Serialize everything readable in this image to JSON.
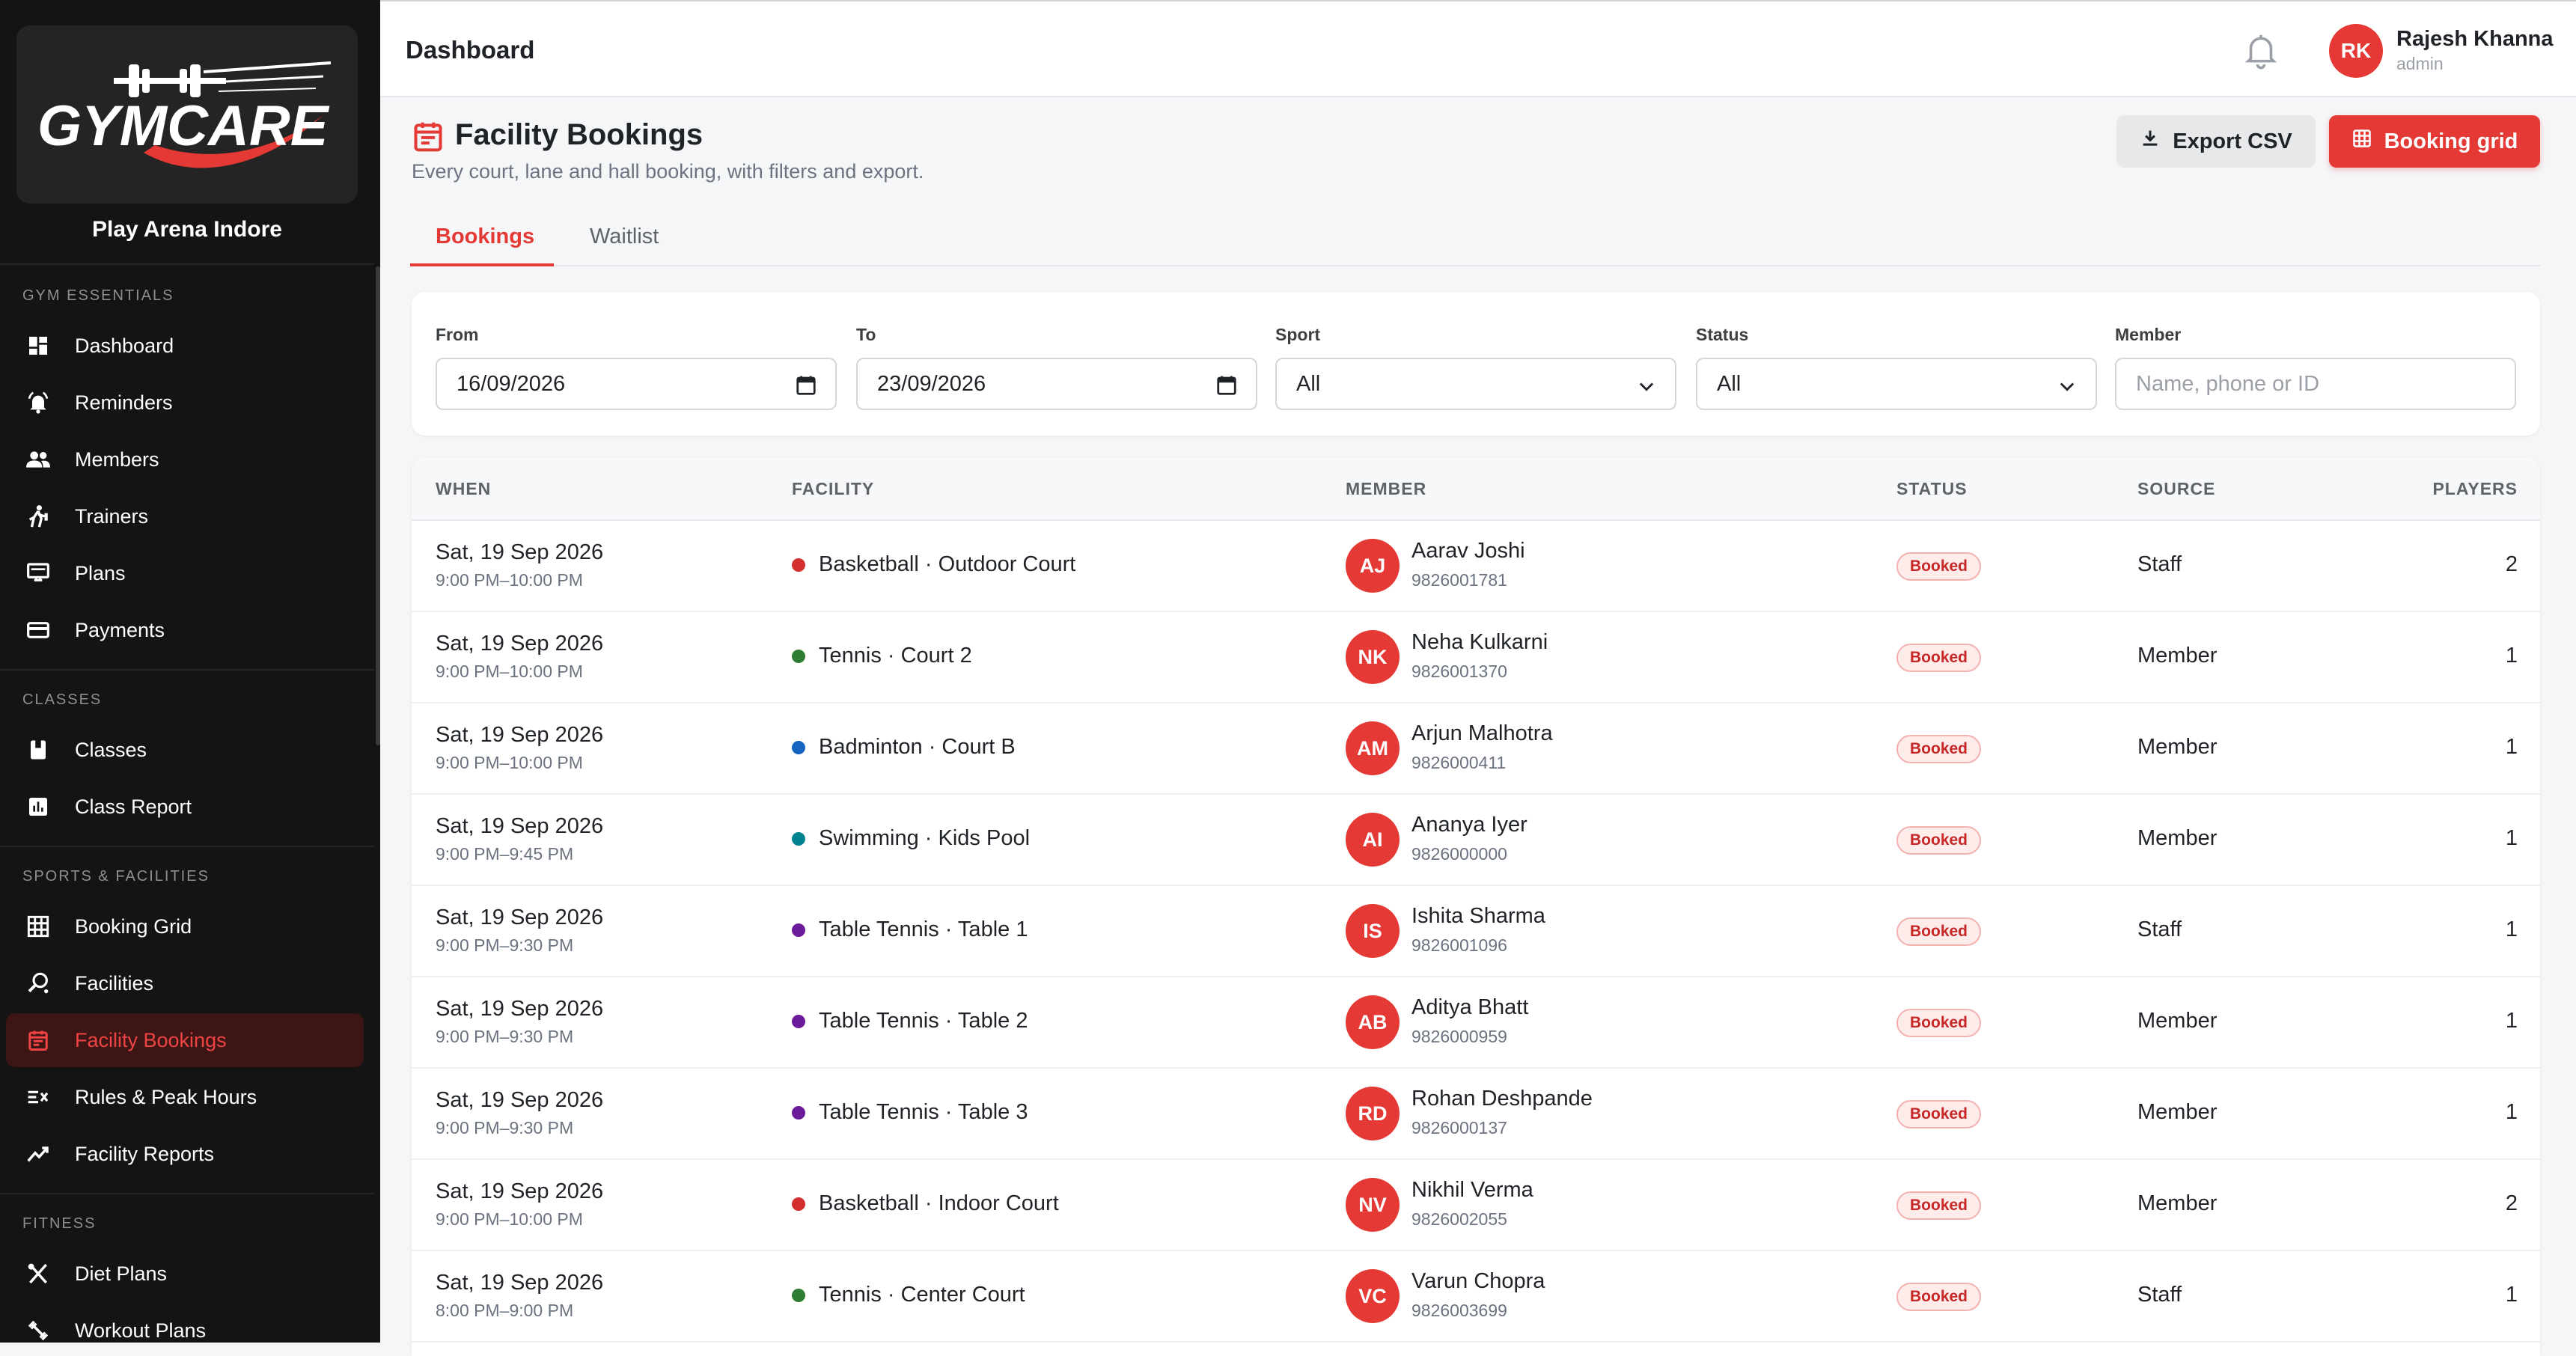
{
  "brand": {
    "logo_text": "GYMCARE",
    "arena": "Play Arena Indore"
  },
  "colors": {
    "accent": "#e53935",
    "sidebar_bg": "#141414",
    "active_bg": "#3d1515"
  },
  "sidebar": {
    "sections": [
      {
        "label": "GYM ESSENTIALS"
      },
      {
        "label": "CLASSES"
      },
      {
        "label": "SPORTS & FACILITIES"
      },
      {
        "label": "FITNESS"
      }
    ],
    "items": [
      {
        "label": "Dashboard",
        "icon": "dashboard-icon"
      },
      {
        "label": "Reminders",
        "icon": "bell-ring-icon"
      },
      {
        "label": "Members",
        "icon": "people-icon"
      },
      {
        "label": "Trainers",
        "icon": "trainer-icon"
      },
      {
        "label": "Plans",
        "icon": "plans-icon"
      },
      {
        "label": "Payments",
        "icon": "card-icon"
      },
      {
        "label": "Classes",
        "icon": "book-icon"
      },
      {
        "label": "Class Report",
        "icon": "bar-chart-icon"
      },
      {
        "label": "Booking Grid",
        "icon": "grid-icon"
      },
      {
        "label": "Facilities",
        "icon": "racket-icon"
      },
      {
        "label": "Facility Bookings",
        "icon": "calendar-icon",
        "active": true
      },
      {
        "label": "Rules & Peak Hours",
        "icon": "rules-icon"
      },
      {
        "label": "Facility Reports",
        "icon": "trend-icon"
      },
      {
        "label": "Diet Plans",
        "icon": "utensils-icon"
      },
      {
        "label": "Workout Plans",
        "icon": "dumbbell-icon"
      }
    ]
  },
  "topbar": {
    "title": "Dashboard",
    "user_initials": "RK",
    "user_name": "Rajesh Khanna",
    "user_role": "admin"
  },
  "page": {
    "title": "Facility Bookings",
    "subtitle": "Every court, lane and hall booking, with filters and export.",
    "export_label": "Export CSV",
    "grid_label": "Booking grid"
  },
  "tabs": [
    {
      "label": "Bookings",
      "active": true
    },
    {
      "label": "Waitlist"
    }
  ],
  "filters": {
    "from_label": "From",
    "from_value": "16/09/2026",
    "to_label": "To",
    "to_value": "23/09/2026",
    "sport_label": "Sport",
    "sport_value": "All",
    "status_label": "Status",
    "status_value": "All",
    "member_label": "Member",
    "member_placeholder": "Name, phone or ID"
  },
  "table": {
    "headers": {
      "when": "WHEN",
      "facility": "FACILITY",
      "member": "MEMBER",
      "status": "STATUS",
      "source": "SOURCE",
      "players": "PLAYERS"
    },
    "rows": [
      {
        "date": "Sat, 19 Sep 2026",
        "time": "9:00 PM–10:00 PM",
        "facility": "Basketball · Outdoor Court",
        "dot": "#d32f2f",
        "initials": "AJ",
        "name": "Aarav Joshi",
        "phone": "9826001781",
        "status": "Booked",
        "source": "Staff",
        "players": "2"
      },
      {
        "date": "Sat, 19 Sep 2026",
        "time": "9:00 PM–10:00 PM",
        "facility": "Tennis · Court 2",
        "dot": "#2e7d32",
        "initials": "NK",
        "name": "Neha Kulkarni",
        "phone": "9826001370",
        "status": "Booked",
        "source": "Member",
        "players": "1"
      },
      {
        "date": "Sat, 19 Sep 2026",
        "time": "9:00 PM–10:00 PM",
        "facility": "Badminton · Court B",
        "dot": "#1565c0",
        "initials": "AM",
        "name": "Arjun Malhotra",
        "phone": "9826000411",
        "status": "Booked",
        "source": "Member",
        "players": "1"
      },
      {
        "date": "Sat, 19 Sep 2026",
        "time": "9:00 PM–9:45 PM",
        "facility": "Swimming · Kids Pool",
        "dot": "#00838f",
        "initials": "AI",
        "name": "Ananya Iyer",
        "phone": "9826000000",
        "status": "Booked",
        "source": "Member",
        "players": "1"
      },
      {
        "date": "Sat, 19 Sep 2026",
        "time": "9:00 PM–9:30 PM",
        "facility": "Table Tennis · Table 1",
        "dot": "#6a1b9a",
        "initials": "IS",
        "name": "Ishita Sharma",
        "phone": "9826001096",
        "status": "Booked",
        "source": "Staff",
        "players": "1"
      },
      {
        "date": "Sat, 19 Sep 2026",
        "time": "9:00 PM–9:30 PM",
        "facility": "Table Tennis · Table 2",
        "dot": "#6a1b9a",
        "initials": "AB",
        "name": "Aditya Bhatt",
        "phone": "9826000959",
        "status": "Booked",
        "source": "Member",
        "players": "1"
      },
      {
        "date": "Sat, 19 Sep 2026",
        "time": "9:00 PM–9:30 PM",
        "facility": "Table Tennis · Table 3",
        "dot": "#6a1b9a",
        "initials": "RD",
        "name": "Rohan Deshpande",
        "phone": "9826000137",
        "status": "Booked",
        "source": "Member",
        "players": "1"
      },
      {
        "date": "Sat, 19 Sep 2026",
        "time": "9:00 PM–10:00 PM",
        "facility": "Basketball · Indoor Court",
        "dot": "#d32f2f",
        "initials": "NV",
        "name": "Nikhil Verma",
        "phone": "9826002055",
        "status": "Booked",
        "source": "Member",
        "players": "2"
      },
      {
        "date": "Sat, 19 Sep 2026",
        "time": "8:00 PM–9:00 PM",
        "facility": "Tennis · Center Court",
        "dot": "#2e7d32",
        "initials": "VC",
        "name": "Varun Chopra",
        "phone": "9826003699",
        "status": "Booked",
        "source": "Staff",
        "players": "1"
      }
    ]
  }
}
